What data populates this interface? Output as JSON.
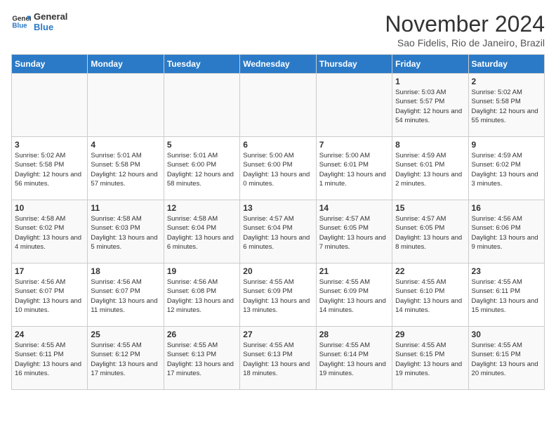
{
  "logo": {
    "line1": "General",
    "line2": "Blue"
  },
  "title": "November 2024",
  "subtitle": "Sao Fidelis, Rio de Janeiro, Brazil",
  "weekdays": [
    "Sunday",
    "Monday",
    "Tuesday",
    "Wednesday",
    "Thursday",
    "Friday",
    "Saturday"
  ],
  "weeks": [
    [
      {
        "day": "",
        "info": ""
      },
      {
        "day": "",
        "info": ""
      },
      {
        "day": "",
        "info": ""
      },
      {
        "day": "",
        "info": ""
      },
      {
        "day": "",
        "info": ""
      },
      {
        "day": "1",
        "info": "Sunrise: 5:03 AM\nSunset: 5:57 PM\nDaylight: 12 hours and 54 minutes."
      },
      {
        "day": "2",
        "info": "Sunrise: 5:02 AM\nSunset: 5:58 PM\nDaylight: 12 hours and 55 minutes."
      }
    ],
    [
      {
        "day": "3",
        "info": "Sunrise: 5:02 AM\nSunset: 5:58 PM\nDaylight: 12 hours and 56 minutes."
      },
      {
        "day": "4",
        "info": "Sunrise: 5:01 AM\nSunset: 5:58 PM\nDaylight: 12 hours and 57 minutes."
      },
      {
        "day": "5",
        "info": "Sunrise: 5:01 AM\nSunset: 6:00 PM\nDaylight: 12 hours and 58 minutes."
      },
      {
        "day": "6",
        "info": "Sunrise: 5:00 AM\nSunset: 6:00 PM\nDaylight: 13 hours and 0 minutes."
      },
      {
        "day": "7",
        "info": "Sunrise: 5:00 AM\nSunset: 6:01 PM\nDaylight: 13 hours and 1 minute."
      },
      {
        "day": "8",
        "info": "Sunrise: 4:59 AM\nSunset: 6:01 PM\nDaylight: 13 hours and 2 minutes."
      },
      {
        "day": "9",
        "info": "Sunrise: 4:59 AM\nSunset: 6:02 PM\nDaylight: 13 hours and 3 minutes."
      }
    ],
    [
      {
        "day": "10",
        "info": "Sunrise: 4:58 AM\nSunset: 6:02 PM\nDaylight: 13 hours and 4 minutes."
      },
      {
        "day": "11",
        "info": "Sunrise: 4:58 AM\nSunset: 6:03 PM\nDaylight: 13 hours and 5 minutes."
      },
      {
        "day": "12",
        "info": "Sunrise: 4:58 AM\nSunset: 6:04 PM\nDaylight: 13 hours and 6 minutes."
      },
      {
        "day": "13",
        "info": "Sunrise: 4:57 AM\nSunset: 6:04 PM\nDaylight: 13 hours and 6 minutes."
      },
      {
        "day": "14",
        "info": "Sunrise: 4:57 AM\nSunset: 6:05 PM\nDaylight: 13 hours and 7 minutes."
      },
      {
        "day": "15",
        "info": "Sunrise: 4:57 AM\nSunset: 6:05 PM\nDaylight: 13 hours and 8 minutes."
      },
      {
        "day": "16",
        "info": "Sunrise: 4:56 AM\nSunset: 6:06 PM\nDaylight: 13 hours and 9 minutes."
      }
    ],
    [
      {
        "day": "17",
        "info": "Sunrise: 4:56 AM\nSunset: 6:07 PM\nDaylight: 13 hours and 10 minutes."
      },
      {
        "day": "18",
        "info": "Sunrise: 4:56 AM\nSunset: 6:07 PM\nDaylight: 13 hours and 11 minutes."
      },
      {
        "day": "19",
        "info": "Sunrise: 4:56 AM\nSunset: 6:08 PM\nDaylight: 13 hours and 12 minutes."
      },
      {
        "day": "20",
        "info": "Sunrise: 4:55 AM\nSunset: 6:09 PM\nDaylight: 13 hours and 13 minutes."
      },
      {
        "day": "21",
        "info": "Sunrise: 4:55 AM\nSunset: 6:09 PM\nDaylight: 13 hours and 14 minutes."
      },
      {
        "day": "22",
        "info": "Sunrise: 4:55 AM\nSunset: 6:10 PM\nDaylight: 13 hours and 14 minutes."
      },
      {
        "day": "23",
        "info": "Sunrise: 4:55 AM\nSunset: 6:11 PM\nDaylight: 13 hours and 15 minutes."
      }
    ],
    [
      {
        "day": "24",
        "info": "Sunrise: 4:55 AM\nSunset: 6:11 PM\nDaylight: 13 hours and 16 minutes."
      },
      {
        "day": "25",
        "info": "Sunrise: 4:55 AM\nSunset: 6:12 PM\nDaylight: 13 hours and 17 minutes."
      },
      {
        "day": "26",
        "info": "Sunrise: 4:55 AM\nSunset: 6:13 PM\nDaylight: 13 hours and 17 minutes."
      },
      {
        "day": "27",
        "info": "Sunrise: 4:55 AM\nSunset: 6:13 PM\nDaylight: 13 hours and 18 minutes."
      },
      {
        "day": "28",
        "info": "Sunrise: 4:55 AM\nSunset: 6:14 PM\nDaylight: 13 hours and 19 minutes."
      },
      {
        "day": "29",
        "info": "Sunrise: 4:55 AM\nSunset: 6:15 PM\nDaylight: 13 hours and 19 minutes."
      },
      {
        "day": "30",
        "info": "Sunrise: 4:55 AM\nSunset: 6:15 PM\nDaylight: 13 hours and 20 minutes."
      }
    ]
  ]
}
